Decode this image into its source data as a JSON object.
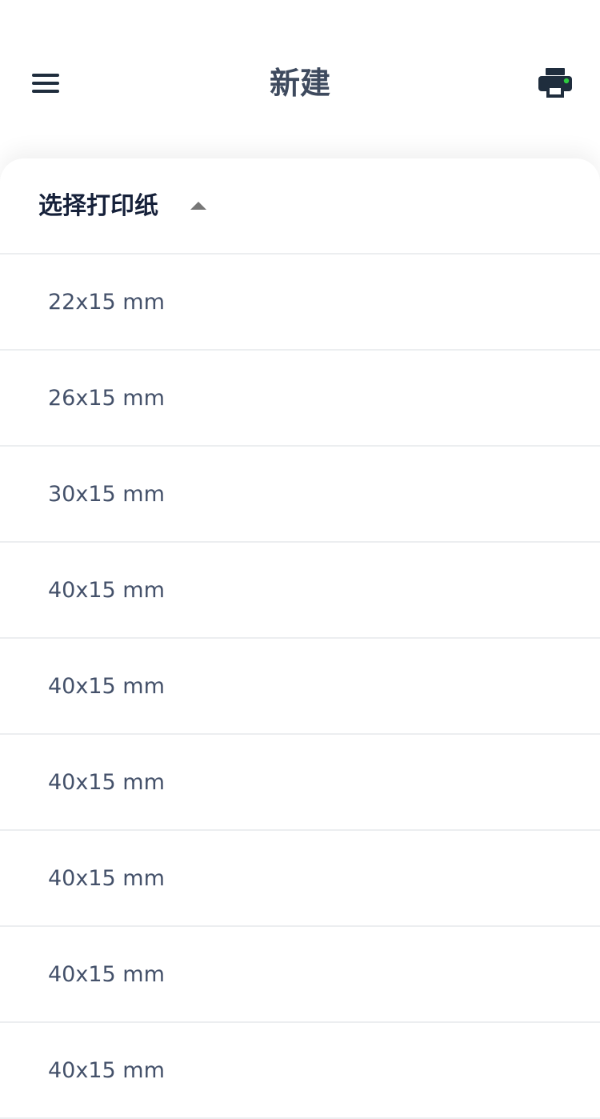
{
  "header": {
    "title": "新建",
    "menu_icon": "menu-icon",
    "printer_icon": "printer-icon",
    "printer_status_color": "#2ecc40"
  },
  "paper_select": {
    "label": "选择打印纸",
    "caret_icon": "caret-up-icon",
    "items": [
      {
        "label": "22x15 mm"
      },
      {
        "label": "26x15 mm"
      },
      {
        "label": "30x15 mm"
      },
      {
        "label": "40x15 mm"
      },
      {
        "label": "40x15 mm"
      },
      {
        "label": "40x15 mm"
      },
      {
        "label": "40x15 mm"
      },
      {
        "label": "40x15 mm"
      },
      {
        "label": "40x15 mm"
      }
    ]
  },
  "colors": {
    "title": "#3e4a5e",
    "icon": "#1f2d3d",
    "item_text": "#44516a",
    "divider": "#eceef0"
  }
}
